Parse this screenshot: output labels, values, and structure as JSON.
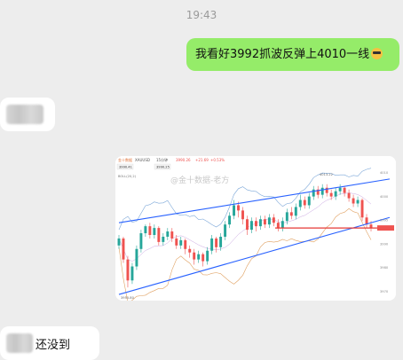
{
  "chat": {
    "timestamp": "19:43",
    "outgoing_message": "我看好3992抓波反弹上4010一线",
    "outgoing_emoji": "sunglasses-emoji",
    "incoming_reply": "还没到"
  },
  "chart_screenshot": {
    "header": {
      "symbol": "XAUUSD",
      "timeframe": "15分钟",
      "price": "3990.26",
      "change": "+21.69",
      "change_pct": "+0.53%",
      "bid_box": "3990.41",
      "ask_box": "3990.25"
    },
    "watermark": "@金十数据-老方",
    "indicator_label": "BOLL(20,2)",
    "price_labels": [
      "4010",
      "4000",
      "3995",
      "3990",
      "3980",
      "3970"
    ],
    "low_label": "3955.80",
    "high_label": "4013.22",
    "colors": {
      "up": "#26a69a",
      "down": "#ef5350",
      "channel": "#2962ff",
      "level": "#e53935"
    }
  },
  "chart_data": {
    "type": "candlestick",
    "ylim": [
      3950,
      4022
    ],
    "level_line": 3990,
    "channel_upper": [
      [
        0,
        3993
      ],
      [
        60,
        4018
      ]
    ],
    "channel_lower": [
      [
        0,
        3952
      ],
      [
        60,
        3996
      ]
    ],
    "candles": [
      [
        3980,
        3984,
        3986,
        3978
      ],
      [
        3984,
        3972,
        3985,
        3970
      ],
      [
        3972,
        3960,
        3974,
        3956
      ],
      [
        3960,
        3968,
        3970,
        3958
      ],
      [
        3968,
        3978,
        3980,
        3966
      ],
      [
        3978,
        3987,
        3989,
        3976
      ],
      [
        3987,
        3991,
        3992,
        3985
      ],
      [
        3991,
        3986,
        3993,
        3984
      ],
      [
        3986,
        3990,
        3992,
        3984
      ],
      [
        3990,
        3982,
        3991,
        3980
      ],
      [
        3982,
        3985,
        3987,
        3980
      ],
      [
        3985,
        3988,
        3990,
        3983
      ],
      [
        3988,
        3984,
        3990,
        3982
      ],
      [
        3984,
        3980,
        3986,
        3978
      ],
      [
        3980,
        3983,
        3985,
        3978
      ],
      [
        3983,
        3978,
        3984,
        3975
      ],
      [
        3978,
        3976,
        3980,
        3973
      ],
      [
        3976,
        3972,
        3978,
        3969
      ],
      [
        3972,
        3975,
        3977,
        3970
      ],
      [
        3975,
        3971,
        3976,
        3968
      ],
      [
        3971,
        3977,
        3979,
        3969
      ],
      [
        3977,
        3984,
        3986,
        3975
      ],
      [
        3984,
        3979,
        3985,
        3976
      ],
      [
        3979,
        3985,
        3987,
        3977
      ],
      [
        3985,
        3992,
        3994,
        3983
      ],
      [
        3992,
        3997,
        3999,
        3990
      ],
      [
        3997,
        4003,
        4006,
        3995
      ],
      [
        4003,
        4000,
        4005,
        3996
      ],
      [
        4000,
        3995,
        4002,
        3992
      ],
      [
        3995,
        3989,
        3997,
        3986
      ],
      [
        3989,
        3994,
        3996,
        3987
      ],
      [
        3994,
        3991,
        3996,
        3988
      ],
      [
        3991,
        3995,
        3997,
        3989
      ],
      [
        3995,
        3992,
        3997,
        3990
      ],
      [
        3992,
        3996,
        3998,
        3990
      ],
      [
        3996,
        3993,
        3998,
        3991
      ],
      [
        3993,
        3990,
        3995,
        3988
      ],
      [
        3990,
        3994,
        3996,
        3988
      ],
      [
        3994,
        3999,
        4001,
        3992
      ],
      [
        3999,
        3997,
        4002,
        3995
      ],
      [
        3997,
        4002,
        4004,
        3995
      ],
      [
        4002,
        4006,
        4009,
        4000
      ],
      [
        4006,
        4003,
        4008,
        4001
      ],
      [
        4003,
        4008,
        4010,
        4001
      ],
      [
        4008,
        4012,
        4014,
        4006
      ],
      [
        4012,
        4009,
        4014,
        4007
      ],
      [
        4009,
        4013,
        4015,
        4007
      ],
      [
        4013,
        4010,
        4015,
        4008
      ],
      [
        4010,
        4008,
        4012,
        4006
      ],
      [
        4008,
        4011,
        4013,
        4006
      ],
      [
        4011,
        4013,
        4015,
        4009
      ],
      [
        4013,
        4010,
        4014,
        4008
      ],
      [
        4010,
        4007,
        4012,
        4005
      ],
      [
        4007,
        4004,
        4009,
        4002
      ],
      [
        4004,
        4006,
        4008,
        4002
      ],
      [
        4006,
        3996,
        4007,
        3994
      ],
      [
        3996,
        3992,
        3998,
        3990
      ],
      [
        3992,
        3990,
        3994,
        3988
      ]
    ]
  }
}
